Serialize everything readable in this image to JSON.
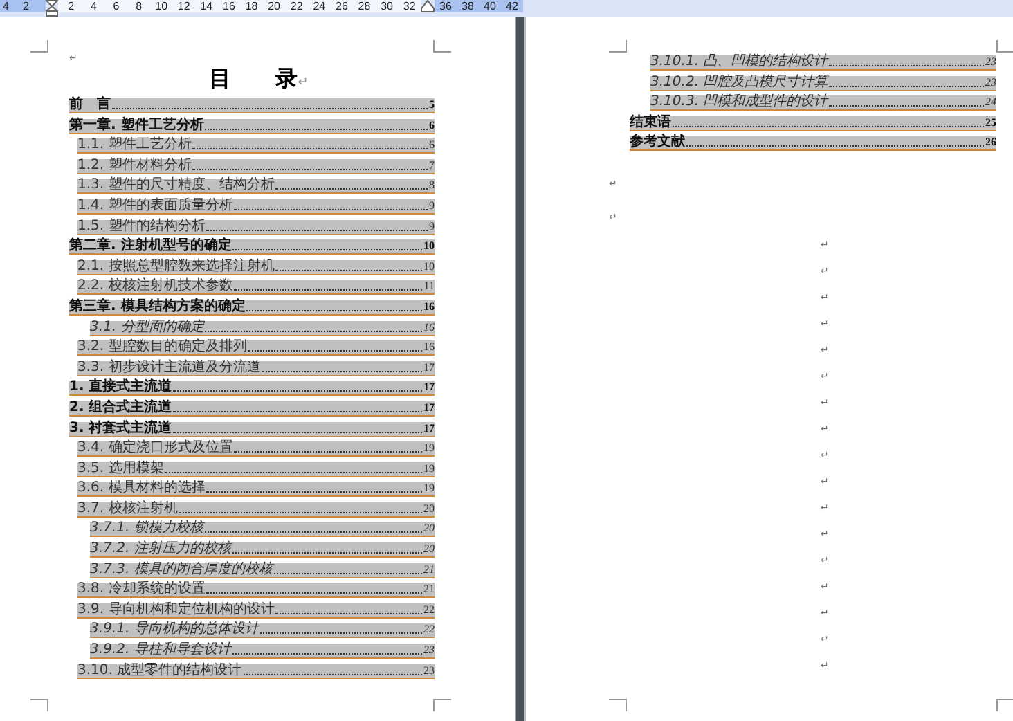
{
  "ruler": {
    "left_numbers": [
      "4",
      "2"
    ],
    "numbers": [
      "2",
      "4",
      "6",
      "8",
      "10",
      "12",
      "14",
      "16",
      "18",
      "20",
      "22",
      "24",
      "26",
      "28",
      "30",
      "32"
    ],
    "right_numbers": [
      "36",
      "38",
      "40",
      "42"
    ]
  },
  "left_page": {
    "top_mark": "↵",
    "title": "目　　录",
    "title_mark": "↵",
    "entries": [
      {
        "kind": "heading",
        "text": "前　言",
        "page": "5"
      },
      {
        "kind": "heading",
        "text": "第一章. 塑件工艺分析",
        "page": "6"
      },
      {
        "kind": "section",
        "text": "1.1. 塑件工艺分析",
        "page": "6"
      },
      {
        "kind": "section",
        "text": "1.2. 塑件材料分析",
        "page": "7"
      },
      {
        "kind": "section",
        "text": "1.3. 塑件的尺寸精度、结构分析",
        "page": "8"
      },
      {
        "kind": "section",
        "text": "1.4. 塑件的表面质量分析",
        "page": "9"
      },
      {
        "kind": "section",
        "text": "1.5. 塑件的结构分析",
        "page": "9"
      },
      {
        "kind": "heading",
        "text": "第二章. 注射机型号的确定",
        "page": "10"
      },
      {
        "kind": "section",
        "text": "2.1. 按照总型腔数来选择注射机",
        "page": "10"
      },
      {
        "kind": "section",
        "text": "2.2. 校核注射机技术参数",
        "page": "11"
      },
      {
        "kind": "heading",
        "text": "第三章. 模具结构方案的确定",
        "page": "16"
      },
      {
        "kind": "subsection",
        "text": "3.1. 分型面的确定",
        "page": "16"
      },
      {
        "kind": "section",
        "text": "3.2. 型腔数目的确定及排列",
        "page": "16"
      },
      {
        "kind": "section",
        "text": "3.3. 初步设计主流道及分流道",
        "page": "17"
      },
      {
        "kind": "heading",
        "text": "1. 直接式主流道",
        "page": "17"
      },
      {
        "kind": "heading",
        "text": "2. 组合式主流道",
        "page": "17"
      },
      {
        "kind": "heading",
        "text": "3. 衬套式主流道",
        "page": "17"
      },
      {
        "kind": "section",
        "text": "3.4. 确定浇口形式及位置",
        "page": "19"
      },
      {
        "kind": "section",
        "text": "3.5. 选用模架",
        "page": "19"
      },
      {
        "kind": "section",
        "text": "3.6. 模具材料的选择",
        "page": "19"
      },
      {
        "kind": "section",
        "text": "3.7. 校核注射机",
        "page": "20"
      },
      {
        "kind": "subsection",
        "text": "3.7.1. 锁模力校核",
        "page": "20"
      },
      {
        "kind": "subsection",
        "text": "3.7.2. 注射压力的校核",
        "page": "20"
      },
      {
        "kind": "subsection",
        "text": "3.7.3. 模具的闭合厚度的校核",
        "page": "21"
      },
      {
        "kind": "section",
        "text": "3.8. 冷却系统的设置",
        "page": "21"
      },
      {
        "kind": "section",
        "text": "3.9. 导向机构和定位机构的设计",
        "page": "22"
      },
      {
        "kind": "subsection",
        "text": "3.9.1. 导向机构的总体设计",
        "page": "22"
      },
      {
        "kind": "subsection",
        "text": "3.9.2. 导柱和导套设计",
        "page": "23"
      },
      {
        "kind": "section",
        "text": "3.10. 成型零件的结构设计",
        "page": "23"
      }
    ]
  },
  "right_page": {
    "entries": [
      {
        "kind": "subsection",
        "text": "3.10.1. 凸、凹模的结构设计",
        "page": "23"
      },
      {
        "kind": "subsection",
        "text": "3.10.2. 凹腔及凸模尺寸计算",
        "page": "23"
      },
      {
        "kind": "subsection",
        "text": "3.10.3. 凹模和成型件的设计",
        "page": "24"
      },
      {
        "kind": "heading",
        "text": "结束语",
        "page": "25"
      },
      {
        "kind": "heading",
        "text": "参考文献",
        "page": "26"
      }
    ],
    "marks": [
      "↵",
      "↵"
    ],
    "column_marks": [
      "↵",
      "↵",
      "↵",
      "↵",
      "↵",
      "↵",
      "↵",
      "↵",
      "↵",
      "↵",
      "↵",
      "↵",
      "↵",
      "↵",
      "↵",
      "↵",
      "↵"
    ]
  }
}
